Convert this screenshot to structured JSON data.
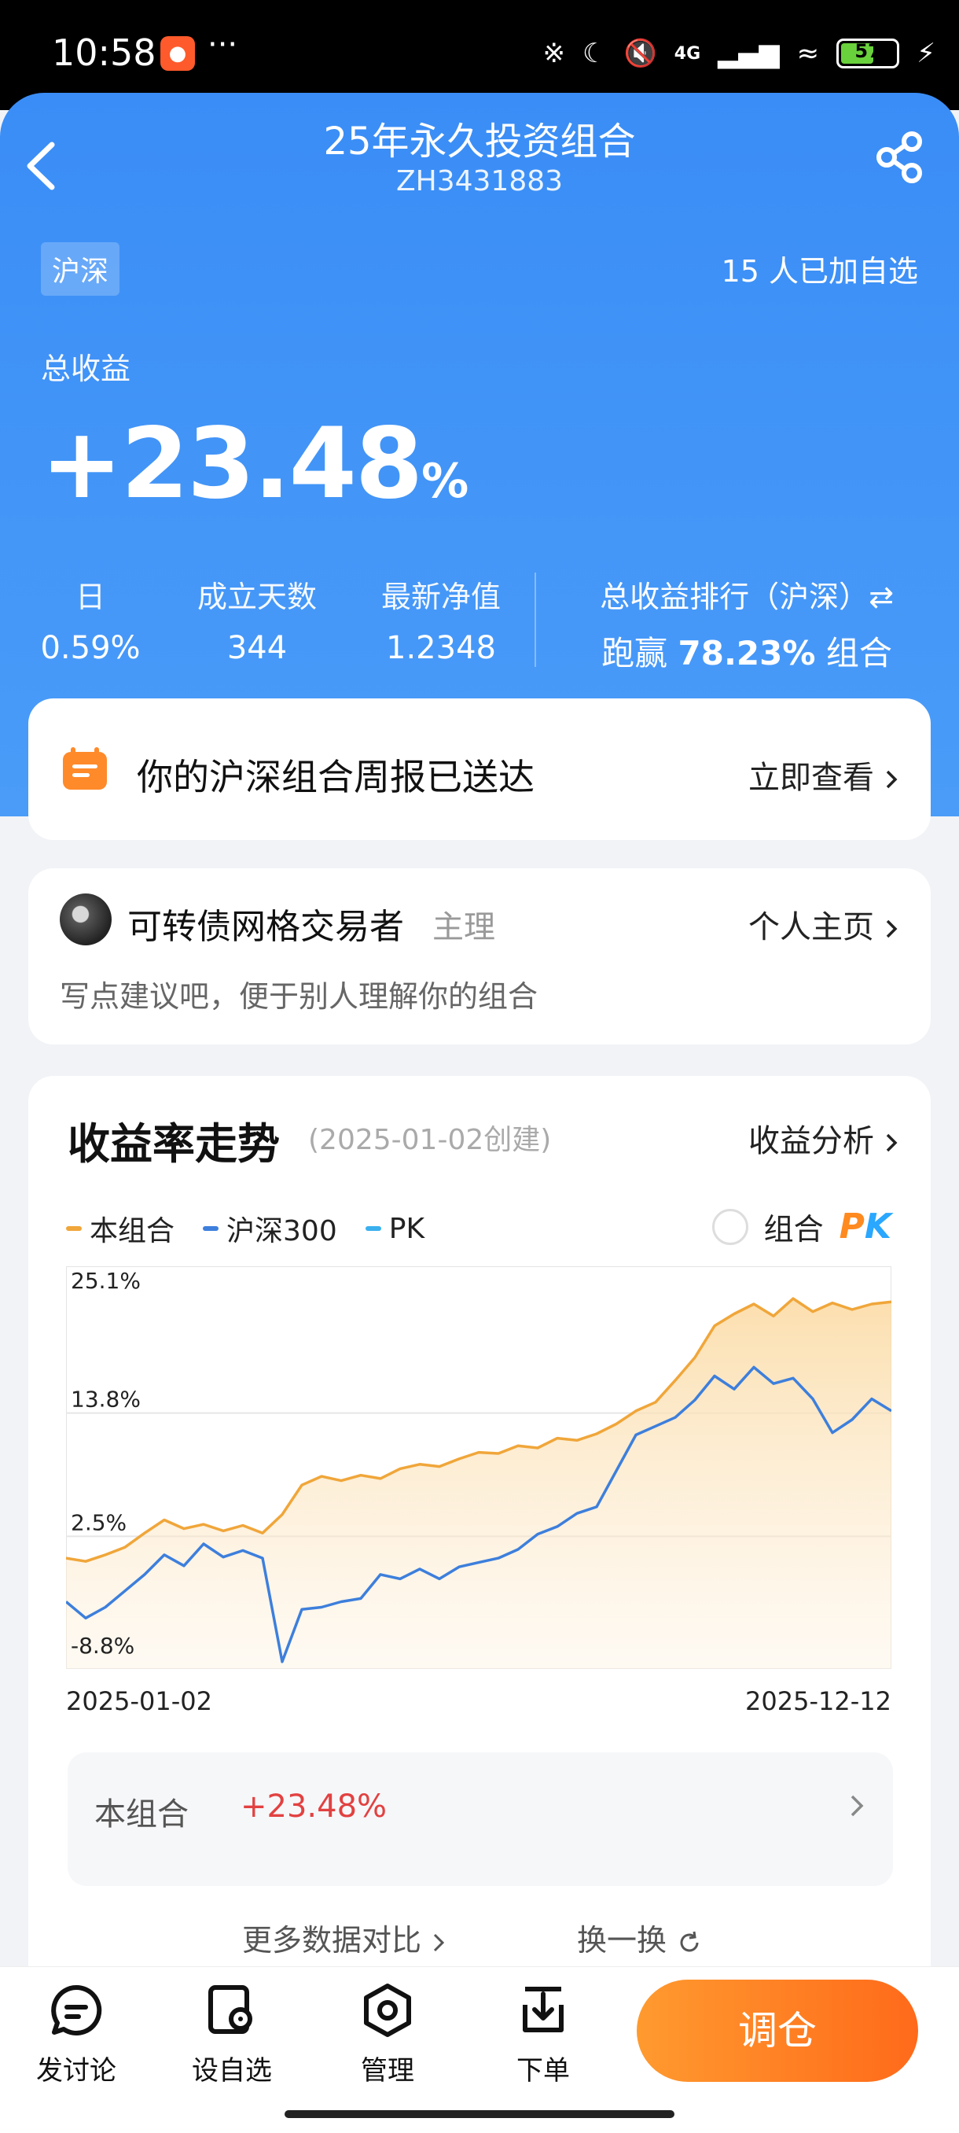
{
  "status_bar": {
    "time": "10:58",
    "dots": "···",
    "network": "4G",
    "battery": "57"
  },
  "header": {
    "title": "25年永久投资组合",
    "code": "ZH3431883",
    "market_tag": "沪深",
    "followers": "15 人已加自选",
    "total_label": "总收益",
    "total_value": "+23.48",
    "total_unit": "%",
    "stats": [
      {
        "label": "日",
        "value": "0.59%"
      },
      {
        "label": "成立天数",
        "value": "344"
      },
      {
        "label": "最新净值",
        "value": "1.2348"
      }
    ],
    "rank": {
      "label": "总收益排行（沪深）⇄",
      "prefix": "跑赢",
      "value": "78.23%",
      "suffix": "组合"
    }
  },
  "report": {
    "text": "你的沪深组合周报已送达",
    "link": "立即查看"
  },
  "owner": {
    "name": "可转债网格交易者",
    "role": "主理",
    "link": "个人主页",
    "hint": "写点建议吧，便于别人理解你的组合"
  },
  "chart_card": {
    "title": "收益率走势",
    "created": "(2025-01-02创建)",
    "link": "收益分析",
    "pk_label": "组合",
    "pk_p": "P",
    "pk_k": "K",
    "compare_label": "本组合",
    "compare_value": "+23.48%",
    "more_data": "更多数据对比",
    "swap": "换一换"
  },
  "chart_data": {
    "type": "line",
    "x_start": "2025-01-02",
    "x_end": "2025-12-12",
    "y_ticks": [
      "25.1%",
      "13.8%",
      "2.5%",
      "-8.8%"
    ],
    "ylim": [
      -8.8,
      25.1
    ],
    "legend": [
      {
        "name": "本组合",
        "color": "#f0a63a"
      },
      {
        "name": "沪深300",
        "color": "#3d7fdc"
      },
      {
        "name": "PK",
        "color": "#3ab0ee"
      }
    ],
    "grid": true,
    "series": [
      {
        "name": "本组合",
        "color": "#f0a63a",
        "values": [
          0.5,
          0.2,
          0.8,
          1.5,
          2.8,
          4.0,
          3.2,
          3.6,
          3.0,
          3.5,
          2.8,
          4.5,
          7.2,
          8.0,
          7.6,
          8.1,
          7.8,
          8.7,
          9.1,
          8.9,
          9.6,
          10.2,
          10.1,
          10.8,
          10.6,
          11.5,
          11.3,
          11.9,
          12.8,
          14.0,
          14.8,
          16.8,
          18.9,
          21.8,
          22.9,
          23.8,
          22.7,
          24.3,
          23.1,
          23.9,
          23.3,
          23.8,
          24.0
        ]
      },
      {
        "name": "沪深300",
        "color": "#3d7fdc",
        "values": [
          -3.5,
          -5.0,
          -4.0,
          -2.5,
          -1.0,
          0.8,
          -0.2,
          1.8,
          0.6,
          1.2,
          0.5,
          -9.0,
          -4.2,
          -4.0,
          -3.5,
          -3.2,
          -1.0,
          -1.4,
          -0.5,
          -1.4,
          -0.3,
          0.1,
          0.5,
          1.3,
          2.7,
          3.4,
          4.6,
          5.2,
          8.5,
          11.8,
          12.6,
          13.4,
          15.0,
          17.2,
          16.0,
          18.0,
          16.5,
          17.0,
          15.1,
          12.0,
          13.2,
          15.1,
          14.0
        ]
      }
    ]
  }
}
